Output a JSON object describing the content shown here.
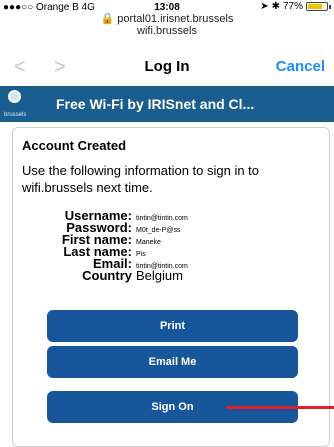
{
  "status": {
    "carrier": "●●●○○ Orange B  4G",
    "time": "13:08",
    "battery": "77%",
    "battery_level": 0.77
  },
  "url": {
    "line1": "portal01.irisnet.brussels",
    "line2": "wifi.brussels"
  },
  "nav": {
    "back": "<",
    "forward": ">",
    "title": "Log In",
    "cancel": "Cancel"
  },
  "banner": {
    "logo_text": "brussels",
    "title": "Free Wi-Fi by IRISnet and Cl..."
  },
  "card": {
    "heading": "Account Created",
    "description": "Use the following information to sign in to wifi.brussels next time.",
    "fields": [
      {
        "label": "Username:",
        "value": "tintin@tintin.com"
      },
      {
        "label": "Password:",
        "value": "M0t_de-P@ss"
      },
      {
        "label": "First name:",
        "value": "Maneke"
      },
      {
        "label": "Last name:",
        "value": "Pis"
      },
      {
        "label": "Email:",
        "value": "tintin@tintin.com"
      },
      {
        "label": "Country",
        "value": "Belgium"
      }
    ],
    "buttons": {
      "print": "Print",
      "email": "Email Me",
      "signon": "Sign On"
    }
  },
  "colors": {
    "accent": "#17569b",
    "banner": "#1a5d8f",
    "link": "#1a8cff",
    "marker": "#e0202a"
  }
}
